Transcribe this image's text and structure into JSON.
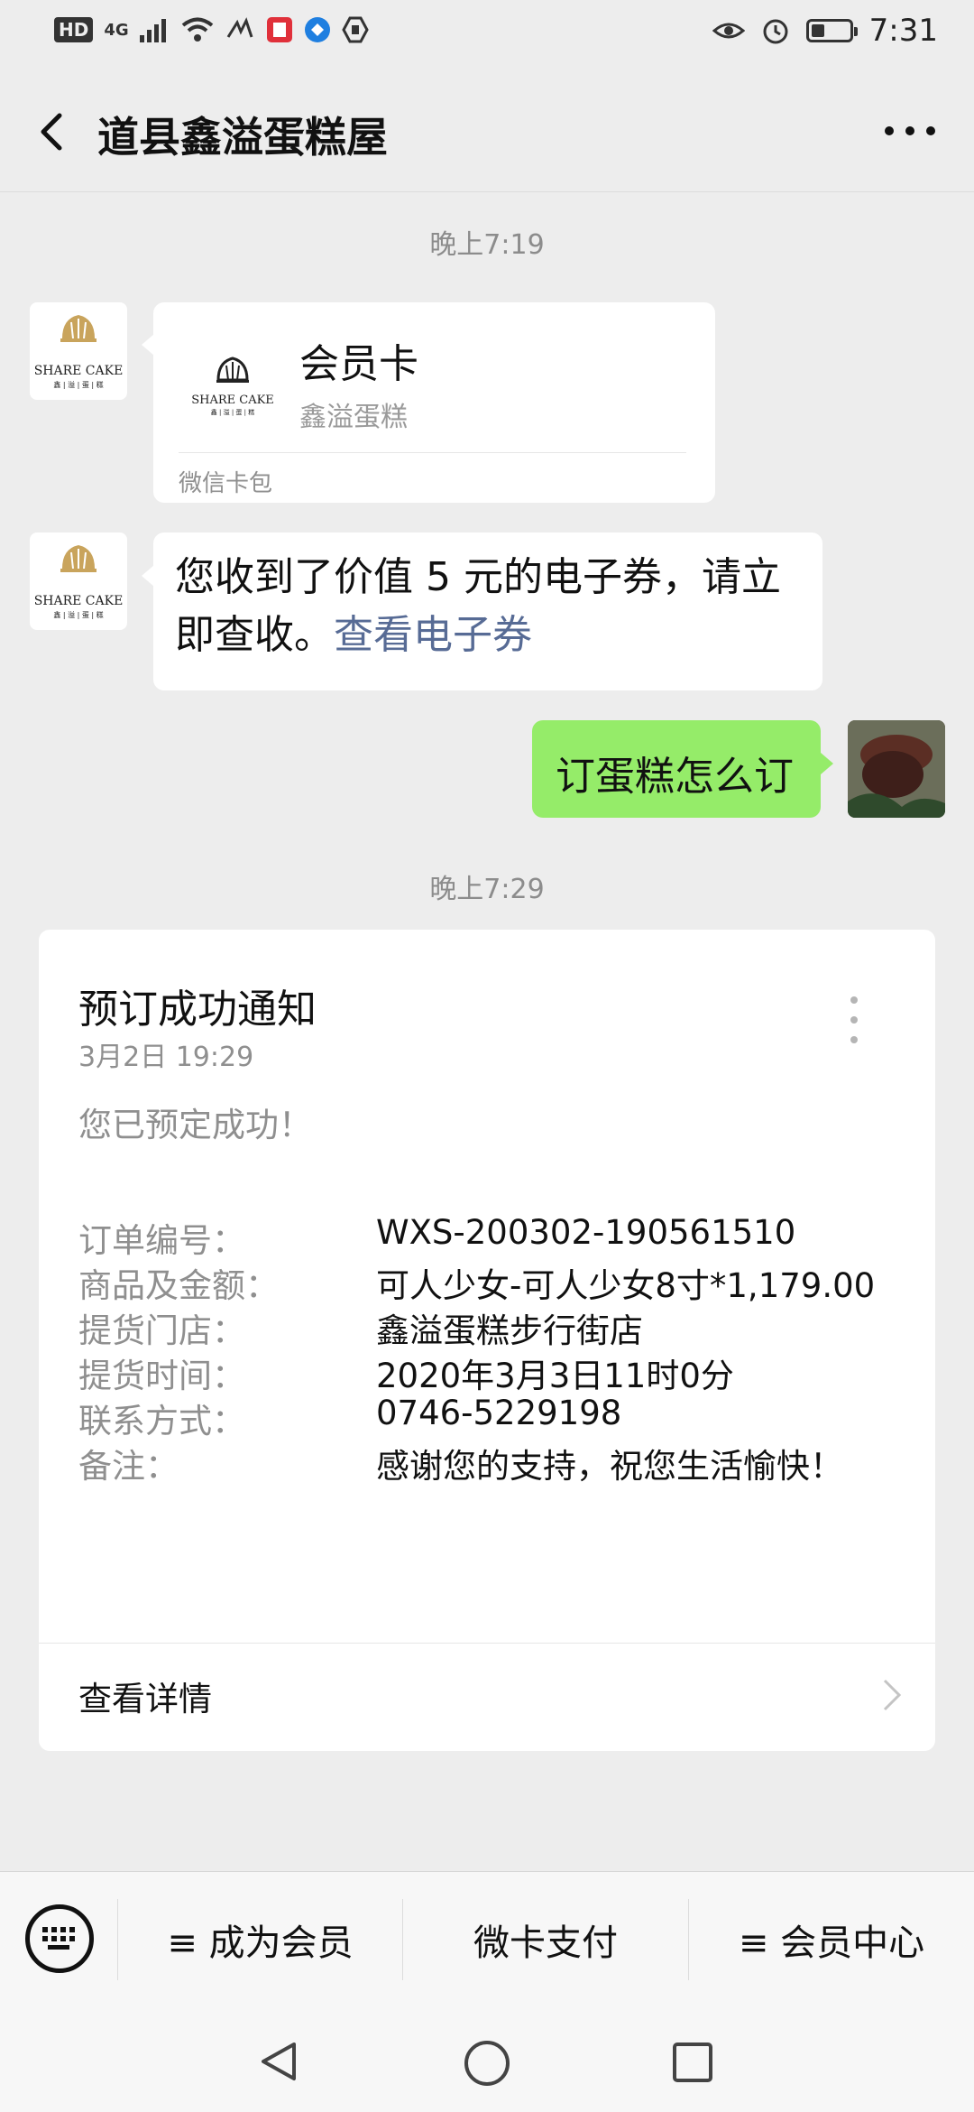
{
  "status_bar": {
    "hd": "HD",
    "network": "4G",
    "time": "7:31",
    "battery_level": 0.35,
    "icons": [
      "signal-icon",
      "wifi-icon",
      "carrier-icon",
      "red-app-icon",
      "blue-app-icon",
      "shield-app-icon",
      "eye-icon",
      "alarm-icon",
      "battery-icon"
    ]
  },
  "header": {
    "title": "道县鑫溢蛋糕屋",
    "back_icon": "back-arrow-icon",
    "more_icon": "more-icon"
  },
  "messages": {
    "timestamp1": "晚上7:19",
    "member_card": {
      "logo_text": "SHARE CAKE",
      "logo_sub": "鑫 | 溢 | 蛋 | 糕",
      "title": "会员卡",
      "subtitle": "鑫溢蛋糕",
      "footer": "微信卡包"
    },
    "coupon": {
      "text": "您收到了价值 5 元的电子券，请立即查收。",
      "link": "查看电子券"
    },
    "user_message": "订蛋糕怎么订",
    "timestamp2": "晚上7:29"
  },
  "notification": {
    "title": "预订成功通知",
    "date": "3月2日  19:29",
    "message": "您已预定成功！",
    "rows": [
      {
        "label": "订单编号：",
        "value": "WXS-200302-190561510"
      },
      {
        "label": "商品及金额：",
        "value": "可人少女-可人少女8寸*1,179.00"
      },
      {
        "label": "提货门店：",
        "value": "鑫溢蛋糕步行街店"
      },
      {
        "label": "提货时间：",
        "value": "2020年3月3日11时0分"
      },
      {
        "label": "联系方式：",
        "value": "0746-5229198"
      },
      {
        "label": "备注：",
        "value": "感谢您的支持，祝您生活愉快！"
      }
    ],
    "detail_label": "查看详情"
  },
  "menu": {
    "keyboard_icon": "keyboard-icon",
    "items": [
      {
        "label": "≡ 成为会员"
      },
      {
        "label": "微卡支付"
      },
      {
        "label": "≡ 会员中心"
      }
    ]
  },
  "nav": {
    "icons": [
      "nav-back-icon",
      "nav-home-icon",
      "nav-recents-icon"
    ]
  },
  "colors": {
    "background": "#ededed",
    "bubble_green": "#95ec69",
    "link_blue": "#576b95",
    "gold_logo": "#c9a45c"
  }
}
